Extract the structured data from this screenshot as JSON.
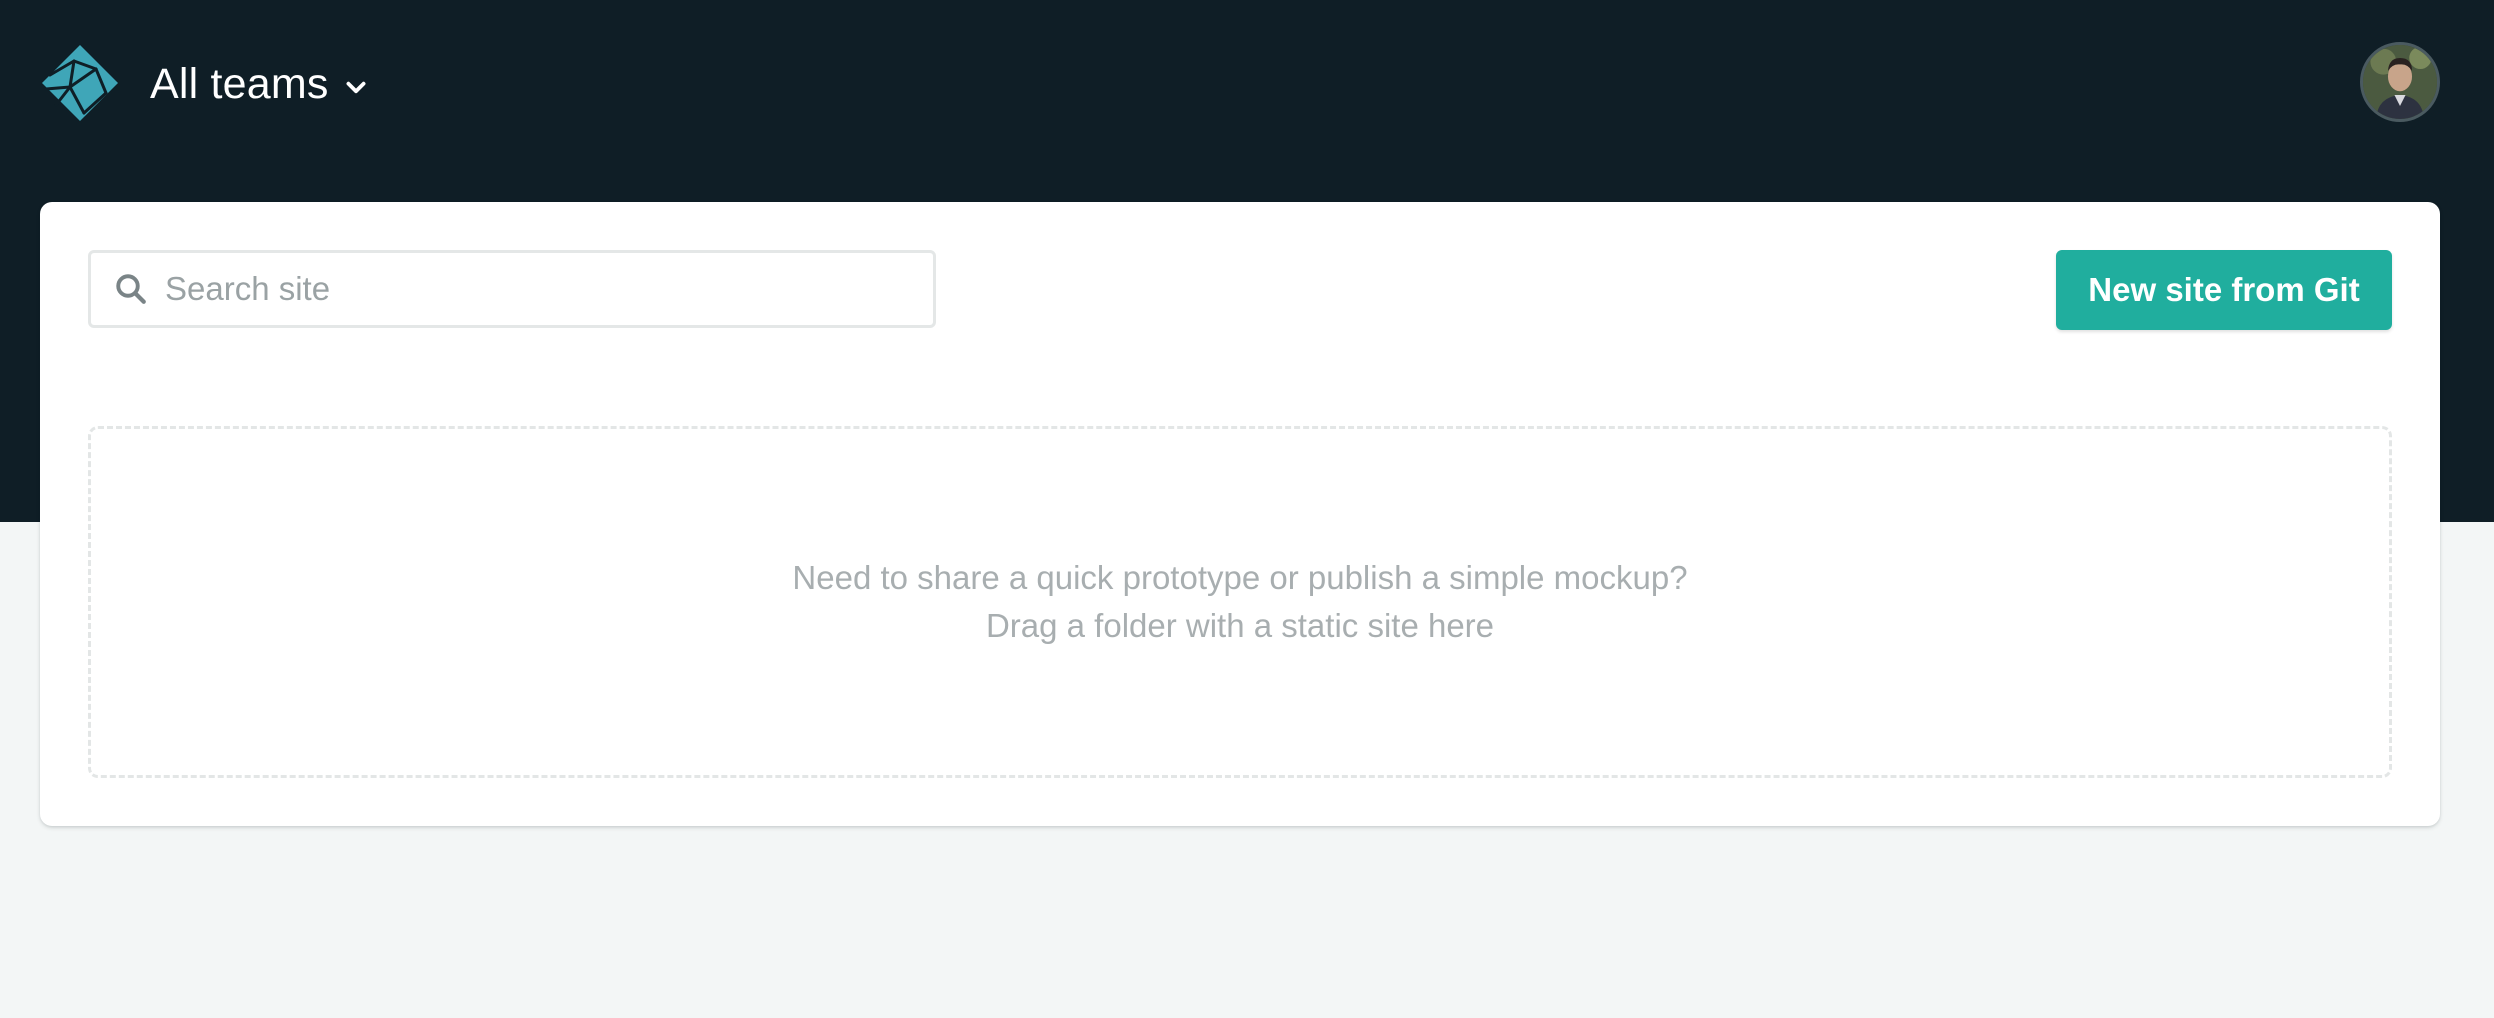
{
  "header": {
    "logo_icon": "netlify-logo-icon",
    "team_label": "All teams",
    "chevron_icon": "chevron-down-icon",
    "avatar_icon": "user-avatar-icon"
  },
  "toolbar": {
    "search_icon": "search-icon",
    "search_placeholder": "Search site",
    "search_value": "",
    "new_site_label": "New site from Git"
  },
  "dropzone": {
    "line1": "Need to share a quick prototype or publish a simple mockup?",
    "line2": "Drag a folder with a static site here"
  },
  "colors": {
    "header_bg": "#0f1e26",
    "page_bg": "#f3f6f6",
    "accent": "#20ae9e",
    "logo": "#3fa6b8"
  }
}
